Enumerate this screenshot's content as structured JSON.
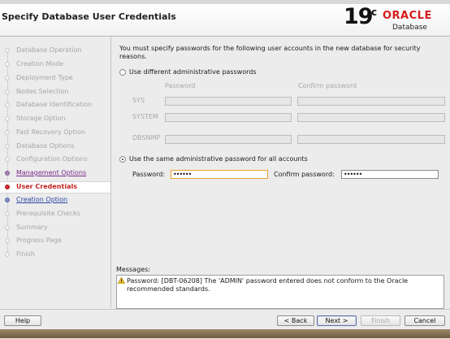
{
  "header": {
    "title": "Specify Database User Credentials",
    "version_number": "19",
    "version_suffix": "c",
    "brand": "ORACLE",
    "product": "Database"
  },
  "steps": [
    {
      "label": "Database Operation",
      "state": "inactive"
    },
    {
      "label": "Creation Mode",
      "state": "inactive"
    },
    {
      "label": "Deployment Type",
      "state": "inactive"
    },
    {
      "label": "Nodes Selection",
      "state": "inactive"
    },
    {
      "label": "Database Identification",
      "state": "inactive"
    },
    {
      "label": "Storage Option",
      "state": "inactive"
    },
    {
      "label": "Fast Recovery Option",
      "state": "inactive"
    },
    {
      "label": "Database Options",
      "state": "inactive"
    },
    {
      "label": "Configuration Options",
      "state": "inactive"
    },
    {
      "label": "Management Options",
      "state": "done"
    },
    {
      "label": "User Credentials",
      "state": "current"
    },
    {
      "label": "Creation Option",
      "state": "link"
    },
    {
      "label": "Prerequisite Checks",
      "state": "inactive"
    },
    {
      "label": "Summary",
      "state": "inactive"
    },
    {
      "label": "Progress Page",
      "state": "inactive"
    },
    {
      "label": "Finish",
      "state": "inactive"
    }
  ],
  "main": {
    "intro_line1": "You must specify passwords for the following user accounts in the new database for security",
    "intro_line2": "reasons.",
    "different_option_label": "Use different administrative passwords",
    "different_option_selected": false,
    "col_password": "Password",
    "col_confirm": "Confirm password",
    "accounts": [
      "SYS",
      "SYSTEM",
      "DBSNMP"
    ],
    "same_option_label": "Use the same administrative password for all accounts",
    "same_option_selected": true,
    "password_label": "Password:",
    "password_value": "••••••",
    "confirm_label": "Confirm password:",
    "confirm_value": "••••••"
  },
  "messages": {
    "label": "Messages:",
    "text_line1": "Password: [DBT-06208] The 'ADMIN' password entered does not conform to the Oracle",
    "text_line2": "recommended standards."
  },
  "footer": {
    "help": "Help",
    "back": "< Back",
    "next": "Next >",
    "finish": "Finish",
    "cancel": "Cancel"
  },
  "colors": {
    "brand_red": "#d51b1b",
    "current_step": "#c22222",
    "link": "#2a44a5"
  }
}
